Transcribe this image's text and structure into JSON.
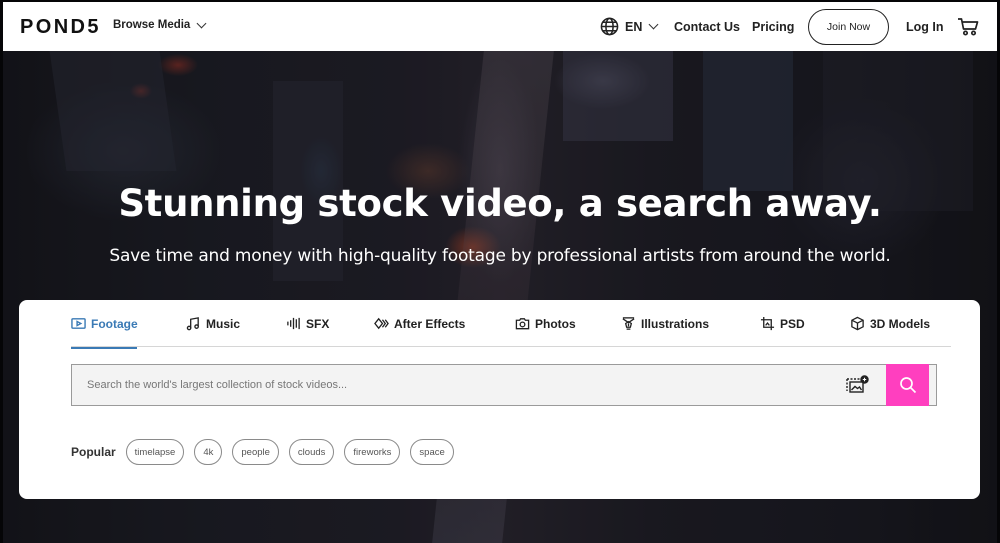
{
  "header": {
    "logo": "POND5",
    "browse_media": "Browse Media",
    "language": "EN",
    "contact": "Contact Us",
    "pricing": "Pricing",
    "join_now": "Join Now",
    "log_in": "Log In"
  },
  "hero": {
    "headline": "Stunning stock video, a search away.",
    "subline": "Save time and money with high-quality footage by professional artists from around the world."
  },
  "search_card": {
    "tabs": [
      {
        "label": "Footage",
        "icon": "play-icon",
        "active": true
      },
      {
        "label": "Music",
        "icon": "music-note-icon"
      },
      {
        "label": "SFX",
        "icon": "sound-wave-icon"
      },
      {
        "label": "After Effects",
        "icon": "after-effects-icon"
      },
      {
        "label": "Photos",
        "icon": "camera-icon"
      },
      {
        "label": "Illustrations",
        "icon": "pen-nib-icon"
      },
      {
        "label": "PSD",
        "icon": "crop-icon"
      },
      {
        "label": "3D Models",
        "icon": "cube-icon"
      }
    ],
    "search_placeholder": "Search the world's largest collection of stock videos...",
    "popular_label": "Popular",
    "popular_tags": [
      "timelapse",
      "4k",
      "people",
      "clouds",
      "fireworks",
      "space"
    ]
  },
  "colors": {
    "accent_blue": "#3a7ab5",
    "search_button": "#ff3fbf"
  }
}
